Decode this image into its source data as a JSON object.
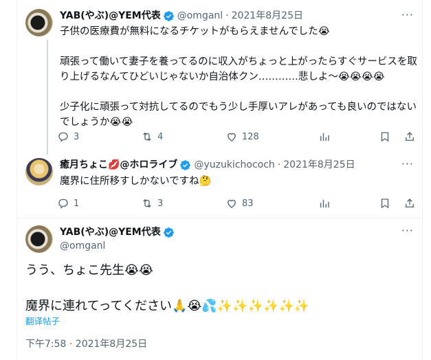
{
  "tweets": [
    {
      "author": "YAB(やぶ)@YEM代表",
      "handle": "@omganl",
      "date": "2021年8月25日",
      "text": "子供の医療費が無料になるチケットがもらえませんでした😭\n\n頑張って働いて妻子を養ってるのに収入がちょっと上がったらすぐサービスを取り上げるなんてひどいじゃないか自治体クン…………悲しよ〜😭😭😭😭\n\n少子化に頑張って対抗してるのでもう少し手厚いアレがあっても良いのではないでしょうか😭😭",
      "replies": "3",
      "retweets": "4",
      "likes": "128"
    },
    {
      "author": "癒月ちょこ💋@ホロライブ",
      "handle": "@yuzukichococh",
      "date": "2021年8月25日",
      "text": "魔界に住所移すしかないですね🤔",
      "replies": "1",
      "retweets": "3",
      "likes": "83"
    }
  ],
  "focus": {
    "author": "YAB(やぶ)@YEM代表",
    "handle": "@omganl",
    "line1": "うう、ちょこ先生😭😭",
    "line2": "魔界に連れてってください🙏😭💦✨✨✨✨✨✨",
    "translate_label": "翻译帖子",
    "timestamp": "下午7:58 · 2021年8月25日"
  },
  "colors": {
    "verified": "#1d9bf0",
    "muted": "#536471",
    "link": "#1d9bf0"
  },
  "icons": {
    "reply": "reply-icon",
    "retweet": "retweet-icon",
    "like": "heart-icon",
    "views": "views-icon",
    "bookmark": "bookmark-icon",
    "share": "share-icon"
  }
}
